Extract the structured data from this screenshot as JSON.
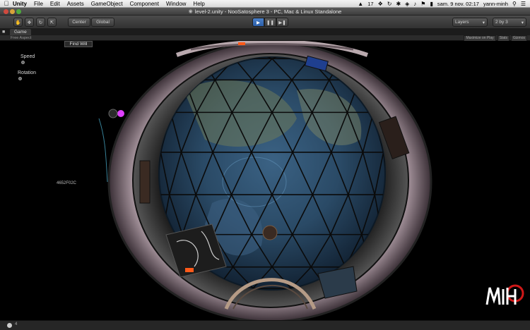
{
  "menubar": {
    "app_name": "Unity",
    "menus": [
      "File",
      "Edit",
      "Assets",
      "GameObject",
      "Component",
      "Window",
      "Help"
    ],
    "tray": {
      "count": "17",
      "datetime": "sam. 9 nov. 02:17",
      "user": "yann-minh"
    }
  },
  "window": {
    "title": "level-2.unity - NooSatosphere 3 - PC, Mac & Linux Standalone"
  },
  "toolbar": {
    "center_label": "Center",
    "global_label": "Global",
    "layers_label": "Layers",
    "layout_label": "2 by 3"
  },
  "game_panel": {
    "tab_label": "Game",
    "aspect_label": "Free Aspect",
    "maximize_label": "Maximize on Play",
    "stats_label": "Stats",
    "gizmos_label": "Gizmos"
  },
  "gui": {
    "find_button": "Find Will",
    "speed_label": "Speed",
    "rotation_label": "Rotation",
    "hex_id": "4652F02C"
  },
  "logo_text": "MiNH",
  "status": {
    "text": "4"
  },
  "colors": {
    "play_accent": "#3a6fbd",
    "ring": "#8a7a86",
    "glow": "#e040ff"
  }
}
